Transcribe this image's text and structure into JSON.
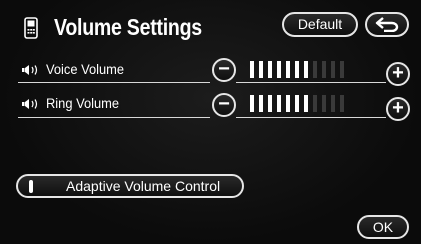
{
  "header": {
    "title": "Volume Settings",
    "title_icon": "phone-handset-icon",
    "default_label": "Default",
    "back_icon": "back-arrow-icon"
  },
  "rows": [
    {
      "label": "Voice Volume",
      "icon": "speaker-icon",
      "level_bars": 7,
      "max_bars": 11
    },
    {
      "label": "Ring Volume",
      "icon": "speaker-icon",
      "level_bars": 7,
      "max_bars": 11
    }
  ],
  "controls": {
    "minus_symbol": "−",
    "plus_symbol": "+"
  },
  "adaptive_volume": {
    "label": "Adaptive Volume Control",
    "state": "on"
  },
  "footer": {
    "ok_label": "OK"
  },
  "colors": {
    "background": "#0c0c0c",
    "foreground": "#ffffff",
    "outline": "#e6e6e6"
  }
}
